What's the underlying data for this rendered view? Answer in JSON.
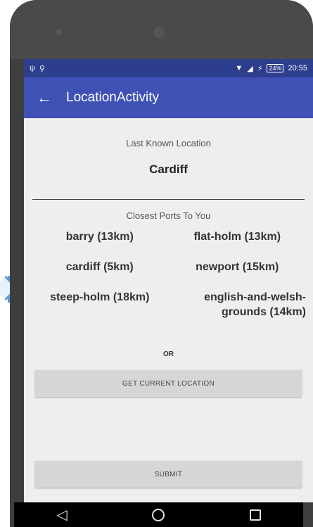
{
  "status_bar": {
    "left_icons": [
      "usb-icon",
      "location-icon"
    ],
    "battery": "24%",
    "time": "20:55"
  },
  "app_bar": {
    "title": "LocationActivity"
  },
  "last_known": {
    "label": "Last Known Location",
    "city": "Cardiff"
  },
  "closest_ports": {
    "label": "Closest Ports To You",
    "ports": [
      "barry (13km)",
      "flat-holm (13km)",
      "cardiff (5km)",
      "newport (15km)",
      "steep-holm (18km)",
      "english-and-welsh-grounds (14km)"
    ]
  },
  "or_label": "OR",
  "buttons": {
    "get_location": "GET CURRENT LOCATION",
    "submit": "SUBMIT"
  },
  "colors": {
    "app_bar": "#3f51b5",
    "status_bar": "#2e3e8e",
    "screen_bg": "#eeeeee",
    "button_bg": "#d6d6d6"
  }
}
